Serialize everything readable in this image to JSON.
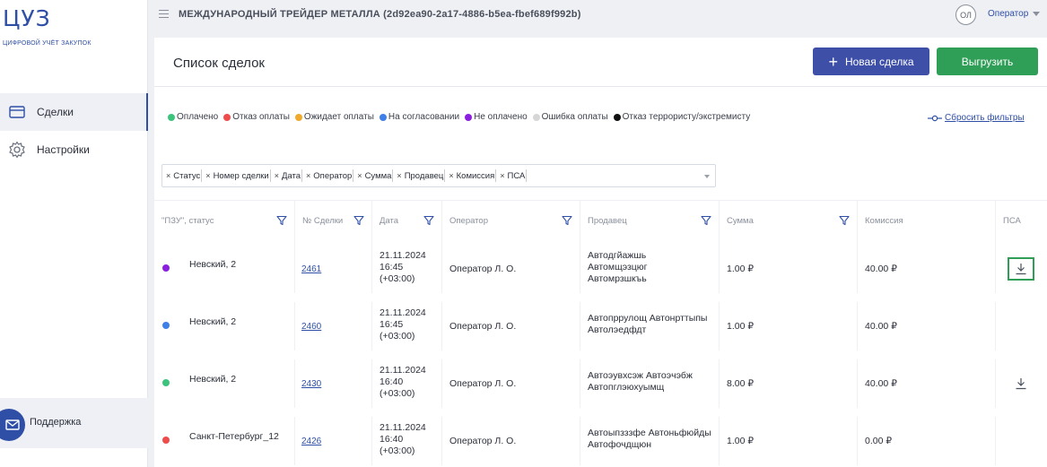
{
  "sidebar": {
    "logo": "ЦУЗ",
    "logo_sub": "ЦИФРОВОЙ УЧЁТ ЗАКУПОК",
    "items": [
      {
        "label": "Сделки",
        "icon": "card-icon",
        "active": true
      },
      {
        "label": "Настройки",
        "icon": "gear-icon",
        "active": false
      }
    ],
    "support_label": "Поддержка"
  },
  "topbar": {
    "company": "МЕЖДУНАРОДНЫЙ ТРЕЙДЕР МЕТАЛЛА (2d92ea90-2a17-4886-b5ea-fbef689f992b)",
    "avatar": "ОЛ",
    "user_role": "Оператор"
  },
  "page": {
    "title": "Список сделок",
    "new_deal": "Новая сделка",
    "export": "Выгрузить",
    "reset_filters": "Сбросить фильтры"
  },
  "legend": [
    {
      "label": "Оплачено",
      "color": "#3cc47c"
    },
    {
      "label": "Отказ оплаты",
      "color": "#ef4b4b"
    },
    {
      "label": "Ожидает оплаты",
      "color": "#f0a92a"
    },
    {
      "label": "На согласовании",
      "color": "#3f7fe8"
    },
    {
      "label": "Не оплачено",
      "color": "#8a1fe0"
    },
    {
      "label": "Ошибка оплаты",
      "color": "#d6d6d6"
    },
    {
      "label": "Отказ террористу/экстремисту",
      "color": "#111111"
    }
  ],
  "column_tags": [
    "Статус",
    "Номер сделки",
    "Дата",
    "Оператор",
    "Сумма",
    "Продавец",
    "Комиссия",
    "ПСА"
  ],
  "table": {
    "headers": [
      "\"ПЗУ\", статус",
      "№ Сделки",
      "Дата",
      "Оператор",
      "Продавец",
      "Сумма",
      "Комиссия",
      "ПСА"
    ],
    "rows": [
      {
        "status_color": "#8a1fe0",
        "location": "Невский, 2",
        "deal": "2461",
        "date1": "21.11.2024",
        "date2": "16:45",
        "date3": "(+03:00)",
        "operator": "Оператор Л. О.",
        "seller1": "Автодгйажшь",
        "seller2": "Автомщэзцюг",
        "seller3": "Автомрзшкъь",
        "sum": "1.00 ₽",
        "commission": "40.00 ₽",
        "psa": true
      },
      {
        "status_color": "#3f7fe8",
        "location": "Невский, 2",
        "deal": "2460",
        "date1": "21.11.2024",
        "date2": "16:45",
        "date3": "(+03:00)",
        "operator": "Оператор Л. О.",
        "seller1": "Автопррулощ Автонрттыпы",
        "seller2": "Автолэедфдт",
        "seller3": "",
        "sum": "1.00 ₽",
        "commission": "40.00 ₽",
        "psa": false
      },
      {
        "status_color": "#3cc47c",
        "location": "Невский, 2",
        "deal": "2430",
        "date1": "21.11.2024",
        "date2": "16:40",
        "date3": "(+03:00)",
        "operator": "Оператор Л. О.",
        "seller1": "Автоэувхсэж Автоэчэбж",
        "seller2": "Автопглэюхуымщ",
        "seller3": "",
        "sum": "8.00 ₽",
        "commission": "40.00 ₽",
        "psa": true
      },
      {
        "status_color": "#ef4b4b",
        "location": "Санкт-Петербург_12",
        "deal": "2426",
        "date1": "21.11.2024",
        "date2": "16:40",
        "date3": "(+03:00)",
        "operator": "Оператор Л. О.",
        "seller1": "Автоыпзззфе Автоньфюйды",
        "seller2": "Автофочдщюн",
        "seller3": "",
        "sum": "1.00 ₽",
        "commission": "0.00 ₽",
        "psa": false
      }
    ]
  }
}
